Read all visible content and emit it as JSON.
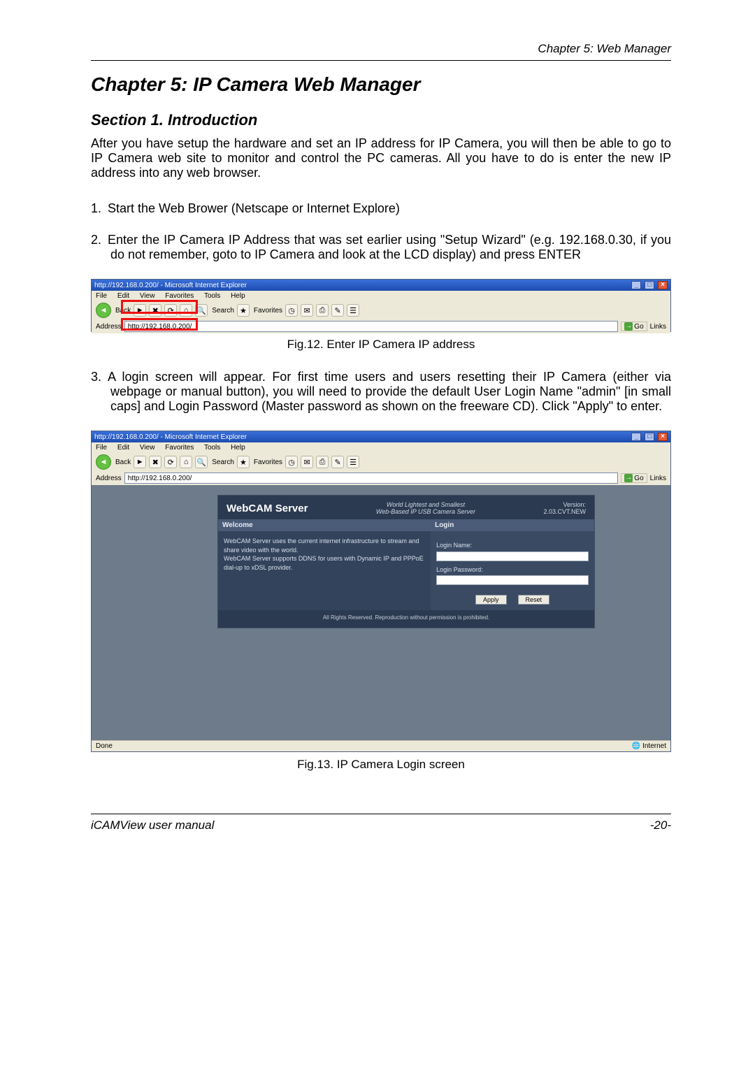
{
  "header": {
    "chapter_label": "Chapter 5: Web Manager"
  },
  "title": "Chapter 5: IP Camera Web Manager",
  "section_title": "Section 1. Introduction",
  "intro": "After you have setup the hardware and set an IP address for IP Camera, you will then be able to go to IP Camera web site to monitor and control the PC cameras. All you have to do is enter the new IP address into any web browser.",
  "steps": {
    "s1": {
      "num": "1.",
      "text": "Start the Web Brower (Netscape or Internet Explore)"
    },
    "s2": {
      "num": "2.",
      "text": "Enter the IP Camera IP Address that was set earlier using \"Setup Wizard\" (e.g. 192.168.0.30, if you do not remember, goto to IP Camera and look at the LCD display) and press ENTER"
    },
    "s3": {
      "num": "3.",
      "text": "A login screen will appear.  For first time users and users resetting their IP Camera (either via webpage or manual button), you will need to provide the default User Login Name \"admin\" [in small caps] and Login Password (Master password as shown on the freeware CD).   Click \"Apply\" to enter."
    }
  },
  "fig12_caption": "Fig.12.  Enter IP Camera IP address",
  "fig13_caption": "Fig.13.  IP Camera Login screen",
  "browser": {
    "title": "http://192.168.0.200/ - Microsoft Internet Explorer",
    "menu": {
      "file": "File",
      "edit": "Edit",
      "view": "View",
      "favorites": "Favorites",
      "tools": "Tools",
      "help": "Help"
    },
    "toolbar": {
      "back": "Back",
      "search": "Search",
      "favorites": "Favorites"
    },
    "address_label": "Address",
    "address_value": "http://192.168.0.200/",
    "go": "Go",
    "links": "Links",
    "status_done": "Done",
    "status_zone": "Internet"
  },
  "webcam": {
    "logo": "WebCAM Server",
    "tag1": "World Lightest and Smallest",
    "tag2": "Web-Based IP USB Camera Server",
    "version_label": "Version:",
    "version_value": "2.03.CVT.NEW",
    "welcome_title": "Welcome",
    "welcome_line1": "WebCAM Server uses the current internet infrastructure to stream and share video with the world.",
    "welcome_line2": "WebCAM Server supports DDNS for users with Dynamic IP and PPPoE dial-up to xDSL provider.",
    "login_title": "Login",
    "login_name_label": "Login Name:",
    "login_pass_label": "Login Password:",
    "apply": "Apply",
    "reset": "Reset",
    "footer": "All Rights Reserved. Reproduction without permission is prohibited."
  },
  "footer": {
    "left": "iCAMView  user  manual",
    "right": "-20-"
  }
}
